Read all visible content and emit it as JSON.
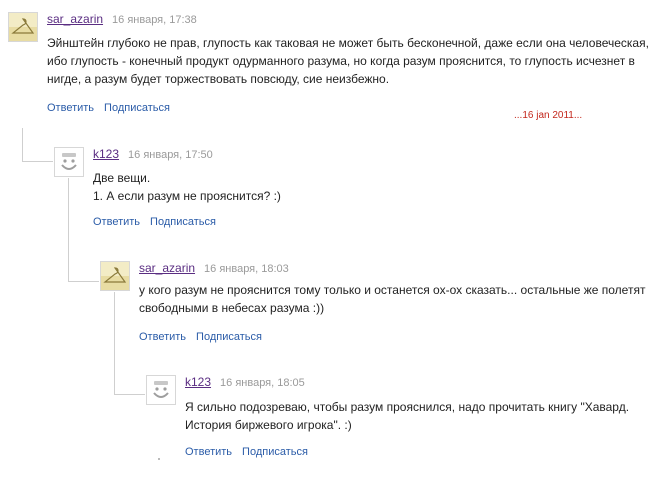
{
  "comments": [
    {
      "author": "sar_azarin",
      "time": "16 января, 17:38",
      "avatar": "sar-azarin-avatar",
      "text": "Эйнштейн глубоко не прав, глупость как таковая не может быть бесконечной, даже если она человеческая, ибо глупость - конечный продукт одурманного разума, но когда разум прояснится, то глупость исчезнет в нигде, а разум будет торжествовать повсюду, сие неизбежно.",
      "reply_label": "Ответить",
      "subscribe_label": "Подписаться"
    },
    {
      "author": "k123",
      "time": "16 января, 17:50",
      "avatar": "smiley-face-avatar",
      "text_lines": [
        "Две вещи.",
        "1. А если разум не прояснится? :)"
      ],
      "reply_label": "Ответить",
      "subscribe_label": "Подписаться"
    },
    {
      "author": "sar_azarin",
      "time": "16 января, 18:03",
      "avatar": "sar-azarin-avatar",
      "text": "у кого разум не прояснится тому только и останется ох-ох сказать... остальные же полетят свободными в небесах разума :))",
      "reply_label": "Ответить",
      "subscribe_label": "Подписаться"
    },
    {
      "author": "k123",
      "time": "16 января, 18:05",
      "avatar": "smiley-face-avatar",
      "text": "Я сильно подозреваю, чтобы разум прояснился, надо прочитать книгу \"Хавард. История биржевого игрока\". :)",
      "reply_label": "Ответить",
      "subscribe_label": "Подписаться"
    }
  ],
  "date_note": "...16 jan 2011...",
  "colors": {
    "author_link": "#5a2d82",
    "action_link": "#2b5ca8",
    "timestamp": "#9a9a9a",
    "note": "#c3271c"
  }
}
